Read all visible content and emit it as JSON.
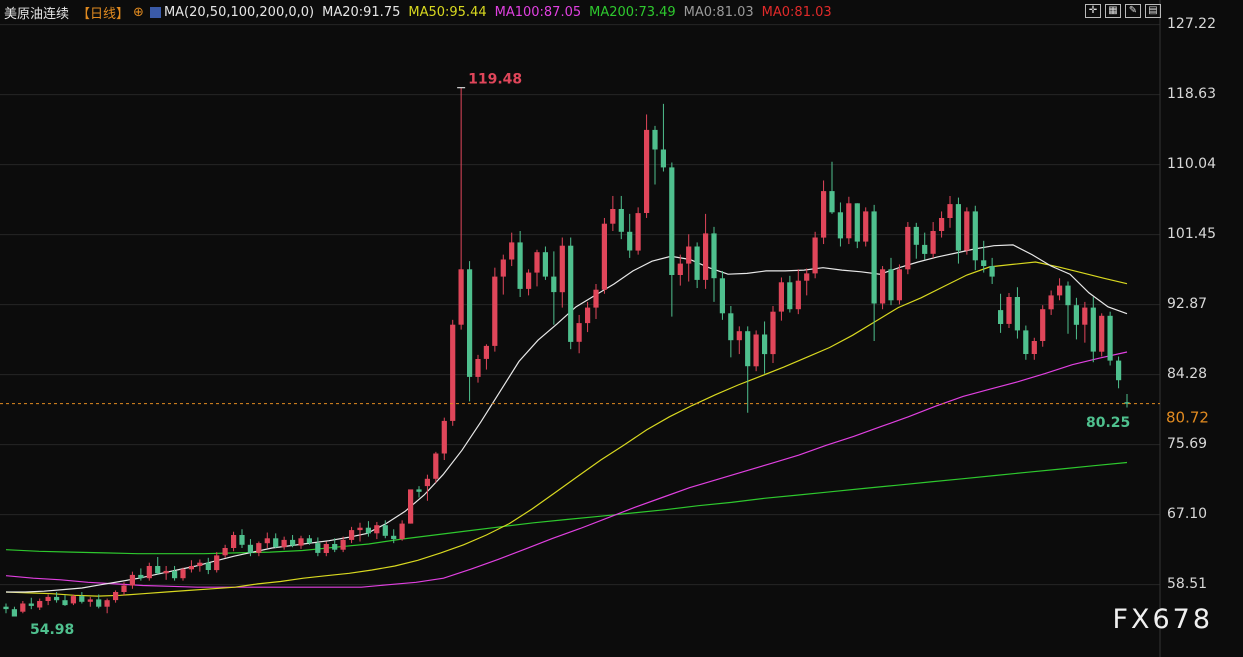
{
  "header": {
    "symbol": "美原油连续",
    "period": "【日线】",
    "ma_params": "MA(20,50,100,200,0,0)",
    "ma20": "MA20:91.75",
    "ma50": "MA50:95.44",
    "ma100": "MA100:87.05",
    "ma200": "MA200:73.49",
    "ma0a": "MA0:81.03",
    "ma0b": "MA0:81.03"
  },
  "colors": {
    "background": "#0c0c0c",
    "up": "#e0465a",
    "down": "#4fc08e",
    "ma20": "#e8e8e8",
    "ma50": "#d8d820",
    "ma100": "#e040e0",
    "ma200": "#2ec82e",
    "price_line": "#e08a20"
  },
  "watermark": "FX678",
  "chart_data": {
    "type": "candlestick",
    "y_ticks": [
      "127.22",
      "118.63",
      "110.04",
      "101.45",
      "92.87",
      "84.28",
      "75.69",
      "67.10",
      "58.51"
    ],
    "ylim": [
      54.0,
      130.0
    ],
    "current_price": 80.72,
    "current_price_label": "80.72",
    "high_label": "119.48",
    "high_value": 119.48,
    "low_label_last": "80.25",
    "low_last_value": 80.25,
    "low_label_first": "54.98",
    "low_first_value": 54.98,
    "candles": [
      [
        55.8,
        56.2,
        55.0,
        55.5
      ],
      [
        55.5,
        55.8,
        54.98,
        54.6
      ],
      [
        55.2,
        56.5,
        55.0,
        56.2
      ],
      [
        56.2,
        56.9,
        55.5,
        55.9
      ],
      [
        55.7,
        56.8,
        55.4,
        56.5
      ],
      [
        56.5,
        57.3,
        56.0,
        57.0
      ],
      [
        57.0,
        57.6,
        56.3,
        56.6
      ],
      [
        56.6,
        57.2,
        55.9,
        56.0
      ],
      [
        56.2,
        57.3,
        56.0,
        57.1
      ],
      [
        57.1,
        57.6,
        56.2,
        56.4
      ],
      [
        56.4,
        57.0,
        55.8,
        56.7
      ],
      [
        56.7,
        57.3,
        55.6,
        55.8
      ],
      [
        55.8,
        56.8,
        55.0,
        56.6
      ],
      [
        56.6,
        57.8,
        56.3,
        57.6
      ],
      [
        57.6,
        58.8,
        57.2,
        58.4
      ],
      [
        58.4,
        60.1,
        58.0,
        59.7
      ],
      [
        59.7,
        60.5,
        59.0,
        59.3
      ],
      [
        59.3,
        61.2,
        59.0,
        60.8
      ],
      [
        60.8,
        61.9,
        59.8,
        59.9
      ],
      [
        59.9,
        60.8,
        59.1,
        60.2
      ],
      [
        60.2,
        60.8,
        59.0,
        59.3
      ],
      [
        59.3,
        60.6,
        59.0,
        60.4
      ],
      [
        60.4,
        61.5,
        60.0,
        60.8
      ],
      [
        60.8,
        61.6,
        60.1,
        61.2
      ],
      [
        61.2,
        61.8,
        59.8,
        60.3
      ],
      [
        60.3,
        62.5,
        60.0,
        62.1
      ],
      [
        62.1,
        63.4,
        61.8,
        63.0
      ],
      [
        63.0,
        65.0,
        62.6,
        64.6
      ],
      [
        64.6,
        65.3,
        63.0,
        63.4
      ],
      [
        63.4,
        64.1,
        62.0,
        62.4
      ],
      [
        62.4,
        63.8,
        62.0,
        63.6
      ],
      [
        63.6,
        64.9,
        63.0,
        64.2
      ],
      [
        64.2,
        64.8,
        63.0,
        63.1
      ],
      [
        63.1,
        64.4,
        62.8,
        64.0
      ],
      [
        64.0,
        64.6,
        63.1,
        63.3
      ],
      [
        63.3,
        64.5,
        62.9,
        64.2
      ],
      [
        64.2,
        64.6,
        63.4,
        63.6
      ],
      [
        63.6,
        64.3,
        62.0,
        62.4
      ],
      [
        62.4,
        63.8,
        62.0,
        63.5
      ],
      [
        63.5,
        64.2,
        62.5,
        62.8
      ],
      [
        62.8,
        64.4,
        62.5,
        64.0
      ],
      [
        64.0,
        65.6,
        63.6,
        65.2
      ],
      [
        65.2,
        66.1,
        63.8,
        65.5
      ],
      [
        65.5,
        66.3,
        64.4,
        64.8
      ],
      [
        64.8,
        66.2,
        64.1,
        65.8
      ],
      [
        65.8,
        66.4,
        64.2,
        64.5
      ],
      [
        64.5,
        65.3,
        63.6,
        64.1
      ],
      [
        64.1,
        66.4,
        63.9,
        66.0
      ],
      [
        66.0,
        66.4,
        69.0,
        70.2
      ],
      [
        70.2,
        70.6,
        69.2,
        69.9
      ],
      [
        70.6,
        72.0,
        68.8,
        71.5
      ],
      [
        71.5,
        74.8,
        71.0,
        74.6
      ],
      [
        74.6,
        79.0,
        73.8,
        78.6
      ],
      [
        78.6,
        91.0,
        78.0,
        90.4
      ],
      [
        90.4,
        119.48,
        89.8,
        97.2
      ],
      [
        97.2,
        98.2,
        81.0,
        84.0
      ],
      [
        84.0,
        86.7,
        83.3,
        86.2
      ],
      [
        86.2,
        88.0,
        84.9,
        87.8
      ],
      [
        87.8,
        97.4,
        87.1,
        96.3
      ],
      [
        96.3,
        99.0,
        94.1,
        98.4
      ],
      [
        98.4,
        101.7,
        97.6,
        100.5
      ],
      [
        100.5,
        101.9,
        93.8,
        94.8
      ],
      [
        94.8,
        97.2,
        94.0,
        96.8
      ],
      [
        96.8,
        99.6,
        95.1,
        99.3
      ],
      [
        99.3,
        100.0,
        95.9,
        96.3
      ],
      [
        96.3,
        99.4,
        90.4,
        94.4
      ],
      [
        94.4,
        101.1,
        92.5,
        100.1
      ],
      [
        100.1,
        101.1,
        87.4,
        88.3
      ],
      [
        88.3,
        91.6,
        86.9,
        90.6
      ],
      [
        90.6,
        93.2,
        89.5,
        92.5
      ],
      [
        92.5,
        95.4,
        91.1,
        94.7
      ],
      [
        94.7,
        103.5,
        94.2,
        102.8
      ],
      [
        102.8,
        106.2,
        101.9,
        104.6
      ],
      [
        104.6,
        106.2,
        100.9,
        101.8
      ],
      [
        101.8,
        104.0,
        98.6,
        99.5
      ],
      [
        99.5,
        104.8,
        99.0,
        104.1
      ],
      [
        104.1,
        116.2,
        103.5,
        114.3
      ],
      [
        114.3,
        114.8,
        107.6,
        111.9
      ],
      [
        111.9,
        117.5,
        109.2,
        109.7
      ],
      [
        109.7,
        110.3,
        91.4,
        96.5
      ],
      [
        96.5,
        99.0,
        95.2,
        97.9
      ],
      [
        97.9,
        101.5,
        95.7,
        100.0
      ],
      [
        100.0,
        100.5,
        94.9,
        95.9
      ],
      [
        95.9,
        104.0,
        94.8,
        101.6
      ],
      [
        101.6,
        102.4,
        93.2,
        96.1
      ],
      [
        96.1,
        97.0,
        91.0,
        91.8
      ],
      [
        91.8,
        92.7,
        86.4,
        88.5
      ],
      [
        88.5,
        90.2,
        86.8,
        89.6
      ],
      [
        89.6,
        90.2,
        79.6,
        85.3
      ],
      [
        85.3,
        89.7,
        84.7,
        89.2
      ],
      [
        89.2,
        90.8,
        84.4,
        86.8
      ],
      [
        86.8,
        92.7,
        85.7,
        92.0
      ],
      [
        92.0,
        96.2,
        90.9,
        95.6
      ],
      [
        95.6,
        96.4,
        91.9,
        92.3
      ],
      [
        92.3,
        97.2,
        91.7,
        95.8
      ],
      [
        95.8,
        97.3,
        94.0,
        96.7
      ],
      [
        96.7,
        101.8,
        96.1,
        101.1
      ],
      [
        101.1,
        108.1,
        100.3,
        106.8
      ],
      [
        106.8,
        110.4,
        104.0,
        104.2
      ],
      [
        104.2,
        105.4,
        100.0,
        101.0
      ],
      [
        101.0,
        106.1,
        100.3,
        105.3
      ],
      [
        105.3,
        105.3,
        99.8,
        100.6
      ],
      [
        100.6,
        104.8,
        100.0,
        104.3
      ],
      [
        104.3,
        105.1,
        88.4,
        93.0
      ],
      [
        93.0,
        97.6,
        92.3,
        97.2
      ],
      [
        97.2,
        98.6,
        92.8,
        93.4
      ],
      [
        93.4,
        97.8,
        92.9,
        97.2
      ],
      [
        97.2,
        103.0,
        96.6,
        102.4
      ],
      [
        102.4,
        102.9,
        98.5,
        100.2
      ],
      [
        100.2,
        101.7,
        98.4,
        99.1
      ],
      [
        99.1,
        103.0,
        98.6,
        101.9
      ],
      [
        101.9,
        104.3,
        101.1,
        103.5
      ],
      [
        103.5,
        106.2,
        102.3,
        105.2
      ],
      [
        105.2,
        106.0,
        97.9,
        99.5
      ],
      [
        99.5,
        104.8,
        99.0,
        104.3
      ],
      [
        104.3,
        105.0,
        97.1,
        98.3
      ],
      [
        98.3,
        100.7,
        96.8,
        97.6
      ],
      [
        97.6,
        98.6,
        95.4,
        96.3
      ],
      [
        92.2,
        94.2,
        89.4,
        90.5
      ],
      [
        90.5,
        94.3,
        90.0,
        93.8
      ],
      [
        93.8,
        95.0,
        88.7,
        89.7
      ],
      [
        89.7,
        90.3,
        86.1,
        86.8
      ],
      [
        86.8,
        88.8,
        86.1,
        88.4
      ],
      [
        88.4,
        92.8,
        87.7,
        92.3
      ],
      [
        92.3,
        94.6,
        91.6,
        94.0
      ],
      [
        94.0,
        96.1,
        93.4,
        95.2
      ],
      [
        95.2,
        95.7,
        89.3,
        92.8
      ],
      [
        92.8,
        93.7,
        88.6,
        90.4
      ],
      [
        90.4,
        93.2,
        88.2,
        92.5
      ],
      [
        92.5,
        93.8,
        85.8,
        87.1
      ],
      [
        87.1,
        91.8,
        86.5,
        91.5
      ],
      [
        91.5,
        92.0,
        85.4,
        86.0
      ],
      [
        86.0,
        86.5,
        82.6,
        83.6
      ],
      [
        80.9,
        81.9,
        80.25,
        80.72
      ]
    ],
    "ma20": [
      57.6,
      57.6,
      57.7,
      57.9,
      58.1,
      58.5,
      58.9,
      59.3,
      59.8,
      60.3,
      60.8,
      61.4,
      62.0,
      62.5,
      63.0,
      63.3,
      63.6,
      63.9,
      64.3,
      64.8,
      66.0,
      67.5,
      69.5,
      72.0,
      75.0,
      78.5,
      82.2,
      85.9,
      88.5,
      90.5,
      92.6,
      94.0,
      95.4,
      97.0,
      98.2,
      98.8,
      98.4,
      97.4,
      96.6,
      96.7,
      97.0,
      97.0,
      97.1,
      97.4,
      97.1,
      96.9,
      96.6,
      97.4,
      98.1,
      98.7,
      99.2,
      99.7,
      100.1,
      100.2,
      99.0,
      97.6,
      96.6,
      94.3,
      92.6,
      91.75
    ],
    "ma50": [
      57.6,
      57.5,
      57.4,
      57.2,
      57.1,
      57.2,
      57.4,
      57.6,
      57.8,
      58.0,
      58.2,
      58.6,
      58.9,
      59.3,
      59.6,
      59.9,
      60.3,
      60.8,
      61.5,
      62.4,
      63.4,
      64.6,
      66.0,
      67.8,
      69.8,
      71.8,
      73.8,
      75.6,
      77.5,
      79.1,
      80.5,
      81.8,
      83.0,
      84.1,
      85.2,
      86.4,
      87.6,
      89.1,
      90.8,
      92.5,
      93.7,
      95.1,
      96.5,
      97.5,
      97.8,
      98.1,
      97.5,
      96.8,
      96.1,
      95.44
    ],
    "ma100": [
      59.6,
      59.3,
      59.1,
      58.8,
      58.6,
      58.4,
      58.3,
      58.2,
      58.2,
      58.2,
      58.2,
      58.2,
      58.2,
      58.2,
      58.5,
      58.8,
      59.3,
      60.4,
      61.6,
      62.9,
      64.2,
      65.4,
      66.7,
      68.0,
      69.2,
      70.4,
      71.4,
      72.4,
      73.4,
      74.4,
      75.6,
      76.7,
      77.9,
      79.1,
      80.4,
      81.6,
      82.5,
      83.4,
      84.4,
      85.5,
      86.3,
      87.05
    ],
    "ma200": [
      62.8,
      62.6,
      62.5,
      62.4,
      62.3,
      62.3,
      62.3,
      62.4,
      62.5,
      62.7,
      63.1,
      63.5,
      64.1,
      64.6,
      65.1,
      65.6,
      66.1,
      66.5,
      66.9,
      67.3,
      67.7,
      68.2,
      68.6,
      69.1,
      69.5,
      69.9,
      70.3,
      70.7,
      71.1,
      71.5,
      71.9,
      72.3,
      72.7,
      73.1,
      73.49
    ]
  }
}
